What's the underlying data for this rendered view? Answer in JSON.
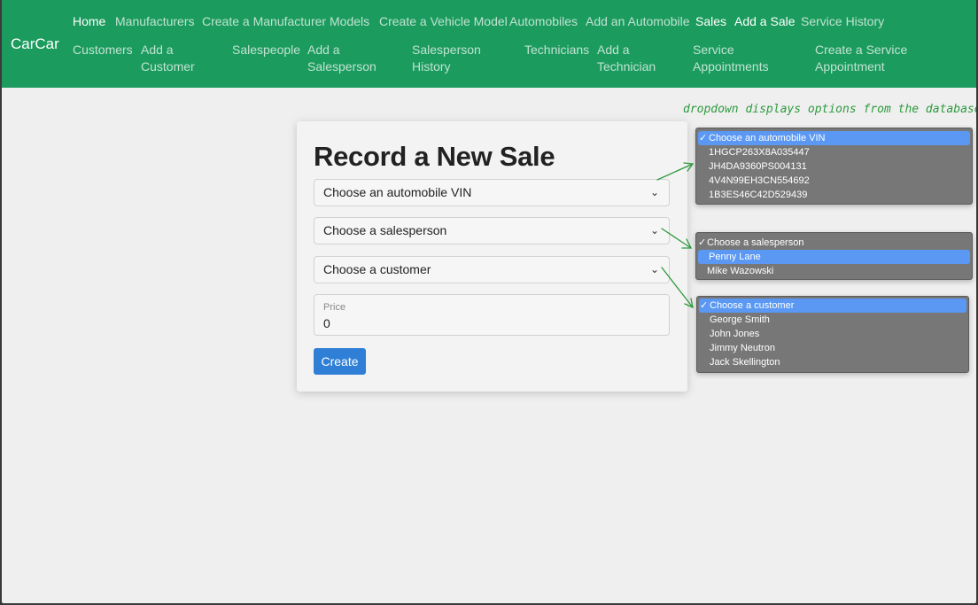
{
  "navbar": {
    "brand": "CarCar",
    "row1": [
      {
        "label": "Home",
        "active": true
      },
      {
        "label": "Manufacturers",
        "active": false
      },
      {
        "label": "Create a Manufacturer",
        "active": false
      },
      {
        "label": "Models",
        "active": false
      },
      {
        "label": "Create a Vehicle Model",
        "active": false
      },
      {
        "label": "Automobiles",
        "active": false
      },
      {
        "label": "Add an Automobile",
        "active": false
      },
      {
        "label": "Sales",
        "active": true
      },
      {
        "label": "Add a Sale",
        "active": true
      },
      {
        "label": "Service History",
        "active": false
      }
    ],
    "row2": [
      {
        "line1": "Customers",
        "line2": ""
      },
      {
        "line1": "Add a",
        "line2": "Customer"
      },
      {
        "line1": "Salespeople",
        "line2": ""
      },
      {
        "line1": "Add a",
        "line2": "Salesperson"
      },
      {
        "line1": "Salesperson",
        "line2": "History"
      },
      {
        "line1": "Technicians",
        "line2": ""
      },
      {
        "line1": "Add a",
        "line2": "Technician"
      },
      {
        "line1": "Service",
        "line2": "Appointments"
      },
      {
        "line1": "Create a Service",
        "line2": "Appointment"
      }
    ]
  },
  "form": {
    "title": "Record a New Sale",
    "vin_select": "Choose an automobile VIN",
    "salesperson_select": "Choose a salesperson",
    "customer_select": "Choose a customer",
    "price_label": "Price",
    "price_value": "0",
    "create_button": "Create"
  },
  "annotation": "dropdown displays options from the database",
  "dropdowns": {
    "vin": {
      "selected": "Choose an automobile VIN",
      "options": [
        "1HGCP263X8A035447",
        "JH4DA9360PS004131",
        "4V4N99EH3CN554692",
        "1B3ES46C42D529439"
      ]
    },
    "salesperson": {
      "placeholder": "Choose a salesperson",
      "highlighted": "Penny Lane",
      "options": [
        "Mike Wazowski"
      ]
    },
    "customer": {
      "selected": "Choose a customer",
      "options": [
        "George Smith",
        "John Jones",
        "Jimmy Neutron",
        "Jack Skellington"
      ]
    }
  },
  "icons": {
    "select_chevron": "chevron-down-icon",
    "checkmark": "✓"
  },
  "colors": {
    "navbar": "#1c9b5e",
    "button": "#2f7fd6",
    "annotation": "#2d9a3e",
    "dropdown_highlight": "#5a98f3"
  }
}
